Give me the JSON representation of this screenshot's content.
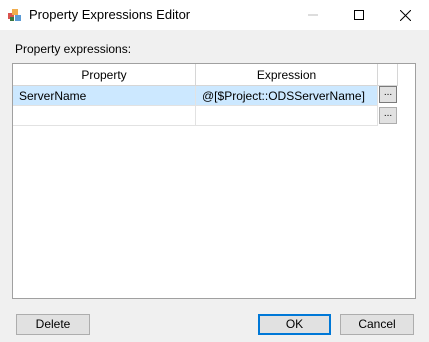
{
  "window": {
    "title": "Property Expressions Editor",
    "controls": [
      "minimize-icon",
      "maximize-icon",
      "close-icon"
    ]
  },
  "section_label": "Property expressions:",
  "grid": {
    "columns": [
      "Property",
      "Expression"
    ],
    "rows": [
      {
        "property": "ServerName",
        "expression": "@[$Project::ODSServerName]",
        "selected": true,
        "ellipsis": "..."
      },
      {
        "property": "",
        "expression": "",
        "selected": false,
        "ellipsis": "..."
      }
    ]
  },
  "buttons": {
    "delete": "Delete",
    "ok": "OK",
    "cancel": "Cancel"
  },
  "colors": {
    "selection": "#cce8ff",
    "default_button_border": "#0078d7"
  }
}
